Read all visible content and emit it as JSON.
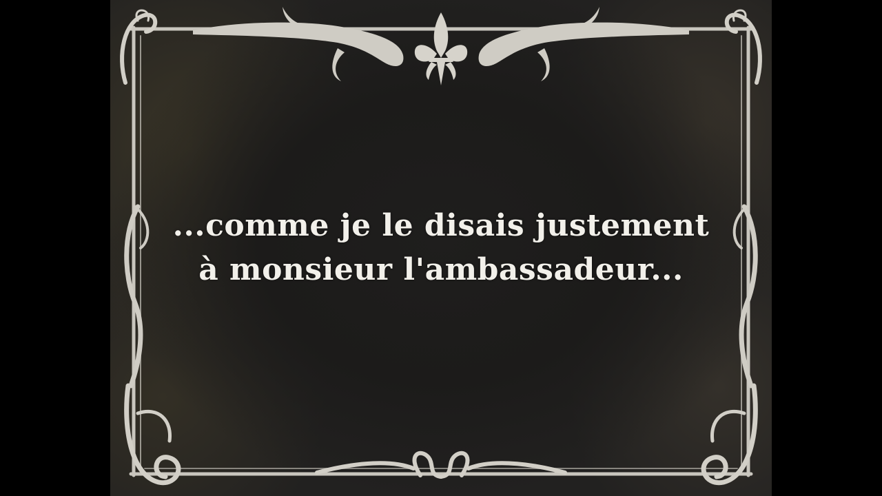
{
  "intertitle": {
    "line1": "...comme je le disais justement",
    "line2": "à monsieur l'ambassadeur..."
  },
  "ornaments": {
    "top_center": "fleur-de-lis-icon",
    "frame": "ornate-silent-film-frame"
  },
  "colors": {
    "background": "#000000",
    "card": "#222120",
    "text": "#f2f0ea",
    "ornament": "#cfccc4"
  }
}
